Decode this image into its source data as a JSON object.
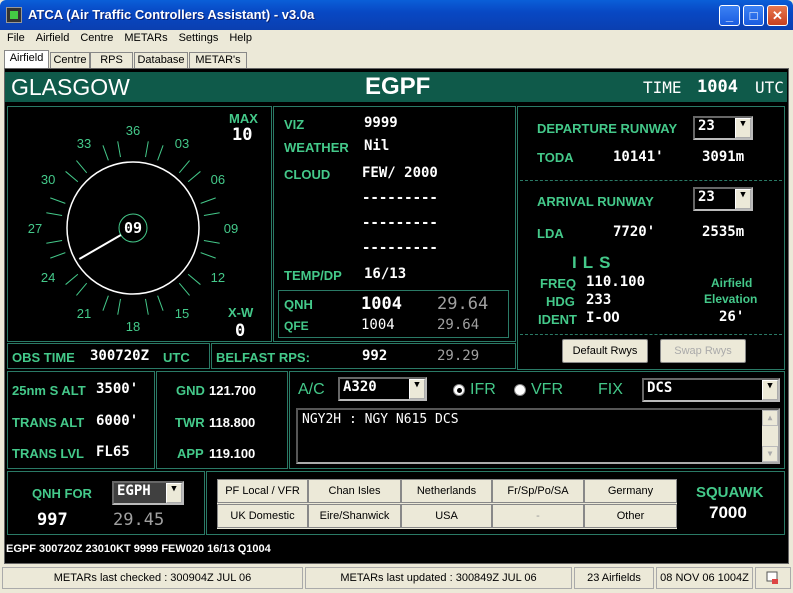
{
  "window": {
    "title": "ATCA (Air Traffic Controllers Assistant) - v3.0a"
  },
  "menu": [
    "File",
    "Airfield",
    "Centre",
    "METARs",
    "Settings",
    "Help"
  ],
  "tabs": [
    "Airfield",
    "Centre",
    "RPS",
    "Database",
    "METAR's"
  ],
  "header": {
    "airfield": "GLASGOW",
    "icao": "EGPF",
    "time_label": "TIME",
    "time": "1004",
    "utc": "UTC"
  },
  "wind": {
    "compass_labels": [
      "36",
      "03",
      "06",
      "09",
      "12",
      "15",
      "18",
      "21",
      "24",
      "27",
      "30",
      "33"
    ],
    "direction": "09",
    "direction_deg": 240,
    "max_label": "MAX",
    "max": "10",
    "xw_label": "X-W",
    "xw": "0"
  },
  "weather": {
    "viz_label": "VIZ",
    "viz": "9999",
    "weather_label": "WEATHER",
    "weather": "Nil",
    "cloud_label": "CLOUD",
    "cloud": [
      "FEW/ 2000",
      "---------",
      "---------",
      "---------"
    ],
    "temp_label": "TEMP/DP",
    "temp": "16/13",
    "qnh_label": "QNH",
    "qnh": "1004",
    "qnh_inhg": "29.64",
    "qfe_label": "QFE",
    "qfe": "1004",
    "qfe_inhg": "29.64"
  },
  "runways": {
    "departure_label": "DEPARTURE RUNWAY",
    "departure": "23",
    "toda_label": "TODA",
    "toda_ft": "10141'",
    "toda_m": "3091m",
    "arrival_label": "ARRIVAL RUNWAY",
    "arrival": "23",
    "lda_label": "LDA",
    "lda_ft": "7720'",
    "lda_m": "2535m",
    "ils_label": "ILS",
    "freq_label": "FREQ",
    "freq": "110.100",
    "hdg_label": "HDG",
    "hdg": "233",
    "ident_label": "IDENT",
    "ident": "I-OO",
    "elev_label1": "Airfield",
    "elev_label2": "Elevation",
    "elev": "26'",
    "default_btn": "Default Rwys",
    "swap_btn": "Swap Rwys"
  },
  "obs": {
    "obs_label": "OBS TIME",
    "obs": "300720Z",
    "obs_utc": "UTC",
    "rps_label": "BELFAST RPS:",
    "rps": "992",
    "rps_inhg": "29.29"
  },
  "altitudes": {
    "alt_label": "25nm S ALT",
    "alt": "3500'",
    "trans_alt_label": "TRANS ALT",
    "trans_alt": "6000'",
    "trans_lvl_label": "TRANS LVL",
    "trans_lvl": "FL65"
  },
  "freqs": {
    "gnd_label": "GND",
    "gnd": "121.700",
    "twr_label": "TWR",
    "twr": "118.800",
    "app_label": "APP",
    "app": "119.100"
  },
  "flight": {
    "ac_label": "A/C",
    "ac": "A320",
    "ifr": "IFR",
    "vfr": "VFR",
    "fix_label": "FIX",
    "fix": "DCS",
    "route": "NGY2H :  NGY N615 DCS"
  },
  "qnh_for": {
    "label": "QNH FOR",
    "airfield": "EGPH",
    "qnh": "997",
    "inhg": "29.45"
  },
  "regions": [
    "PF Local / VFR",
    "Chan Isles",
    "Netherlands",
    "Fr/Sp/Po/SA",
    "Germany",
    "UK Domestic",
    "Eire/Shanwick",
    "USA",
    "-",
    "Other"
  ],
  "squawk": {
    "label": "SQUAWK",
    "code": "7000"
  },
  "metar": "EGPF 300720Z 23010KT 9999 FEW020 16/13 Q1004",
  "status": {
    "checked": "METARs last checked : 300904Z JUL 06",
    "updated": "METARs last updated : 300849Z JUL 06",
    "airfields": "23 Airfields",
    "date": "08 NOV 06 1004Z"
  }
}
